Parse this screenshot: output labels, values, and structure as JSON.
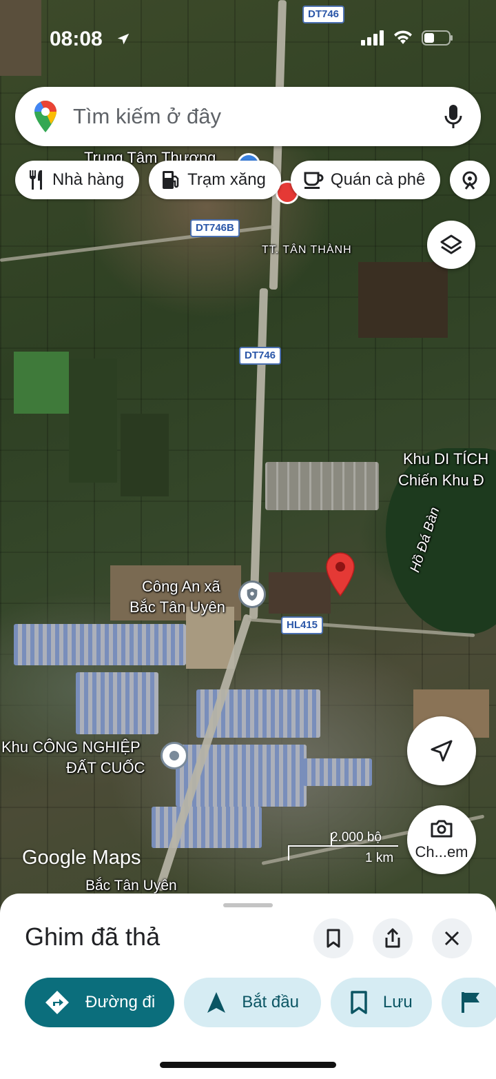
{
  "status_bar": {
    "time": "08:08"
  },
  "search": {
    "placeholder": "Tìm kiếm ở đây"
  },
  "chips": [
    {
      "label": "Nhà hàng",
      "icon": "restaurant-icon"
    },
    {
      "label": "Trạm xăng",
      "icon": "gas-station-icon"
    },
    {
      "label": "Quán cà phê",
      "icon": "coffee-icon"
    }
  ],
  "map": {
    "shields": [
      "DT746",
      "DT746B",
      "DT746",
      "HL415"
    ],
    "labels": {
      "top_poi": "Trung Tâm Thương",
      "town": "TT. TÂN THÀNH",
      "relic_line1": "Khu DI TÍCH",
      "relic_line2": "Chiến Khu Đ",
      "lake": "Hồ Đá Bàn",
      "police_line1": "Công An xã",
      "police_line2": "Bắc Tân Uyên",
      "industrial_line1": "Khu CÔNG NGHIỆP",
      "industrial_line2": "ĐẤT CUỐC",
      "district": "Bắc Tân Uyên"
    },
    "scale": {
      "imperial": "2.000 bộ",
      "metric": "1 km"
    },
    "logo": "Google Maps",
    "street_view_label": "Ch...em"
  },
  "sheet": {
    "title": "Ghim đã thả",
    "actions": [
      {
        "label": "Đường đi",
        "icon": "directions-icon"
      },
      {
        "label": "Bắt đầu",
        "icon": "navigation-arrow-icon"
      },
      {
        "label": "Lưu",
        "icon": "bookmark-icon"
      }
    ]
  },
  "colors": {
    "primary": "#0b6e7c",
    "secondary": "#d6ecf3",
    "pin": "#e53935",
    "shield": "#2a56a8"
  }
}
